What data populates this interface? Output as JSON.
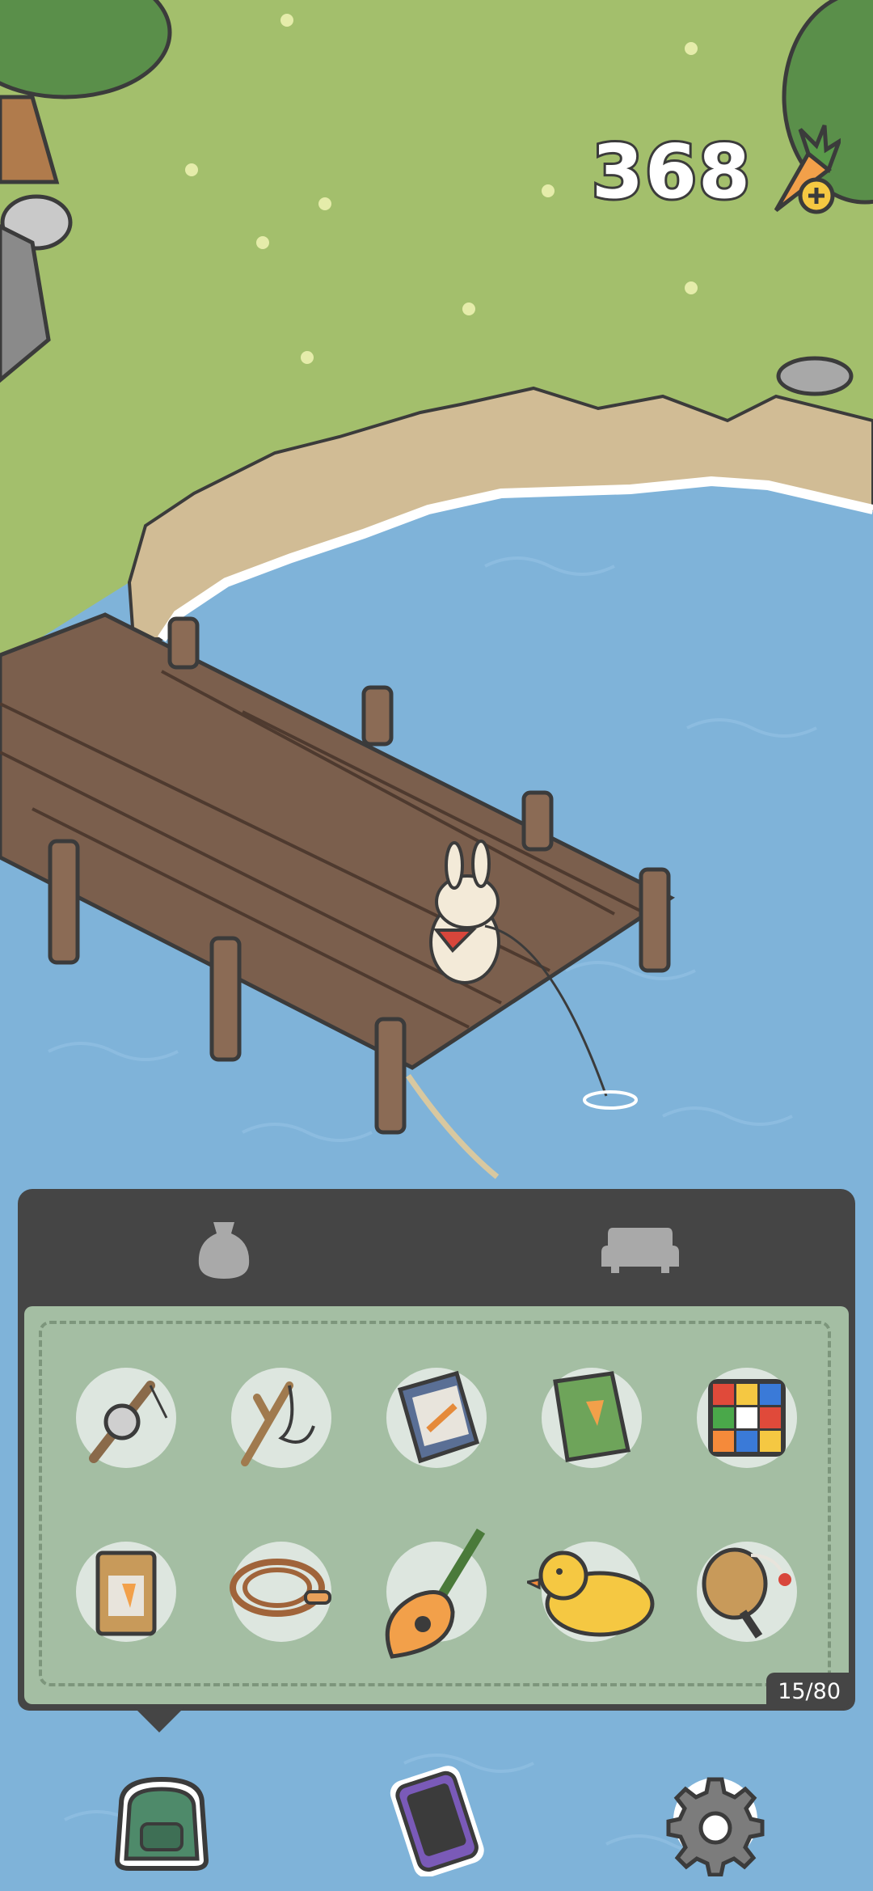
{
  "hud": {
    "carrots": "368",
    "carrot_icon": "carrot-plus-icon"
  },
  "inventory": {
    "tabs": [
      {
        "name": "bag",
        "icon": "bag-icon",
        "selected": true
      },
      {
        "name": "furniture",
        "icon": "sofa-icon",
        "selected": false
      }
    ],
    "items": [
      {
        "icon": "fishing-reel-icon"
      },
      {
        "icon": "slingshot-icon"
      },
      {
        "icon": "notepad-icon"
      },
      {
        "icon": "carrot-book-icon"
      },
      {
        "icon": "rubiks-cube-icon"
      },
      {
        "icon": "seed-packet-icon"
      },
      {
        "icon": "jump-rope-icon"
      },
      {
        "icon": "guitar-icon"
      },
      {
        "icon": "rubber-duck-icon"
      },
      {
        "icon": "maraca-icon"
      }
    ],
    "count": "15/80"
  },
  "bottom_bar": [
    {
      "icon": "backpack-icon"
    },
    {
      "icon": "phone-icon"
    },
    {
      "icon": "gear-icon"
    }
  ],
  "colors": {
    "panel": "#454545",
    "panel_inner": "#a4bea3",
    "grass": "#a3bf6c",
    "water": "#7fb3d9"
  }
}
